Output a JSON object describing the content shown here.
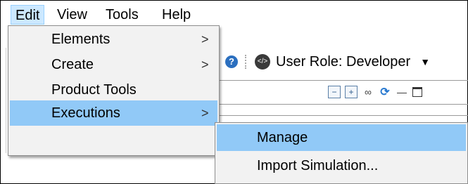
{
  "menubar": {
    "items": [
      {
        "label": "Edit",
        "active": true
      },
      {
        "label": "View",
        "active": false
      },
      {
        "label": "Tools",
        "active": false
      },
      {
        "label": "Help",
        "active": false
      }
    ]
  },
  "toolbar": {
    "help_icon_glyph": "?",
    "role_label": "User Role: Developer",
    "role_dropdown_glyph": "▼",
    "icons": [
      "collapse-all-icon",
      "expand-all-icon",
      "binoculars-icon",
      "refresh-icon",
      "minimize-icon",
      "maximize-icon"
    ]
  },
  "edit_menu": {
    "items": [
      {
        "label": "Elements",
        "has_submenu": true
      },
      {
        "label": "Create",
        "has_submenu": true
      },
      {
        "label": "Product Tools",
        "has_submenu": false
      },
      {
        "label": "Executions",
        "has_submenu": true,
        "highlighted": true
      }
    ],
    "submenu_arrow": ">"
  },
  "executions_submenu": {
    "items": [
      {
        "label": "Manage",
        "highlighted": true
      },
      {
        "label": "Import Simulation..."
      }
    ]
  },
  "colors": {
    "highlight": "#91c9f7",
    "menu_bg": "#f2f2f2",
    "active_menubar": "#cce8ff"
  }
}
